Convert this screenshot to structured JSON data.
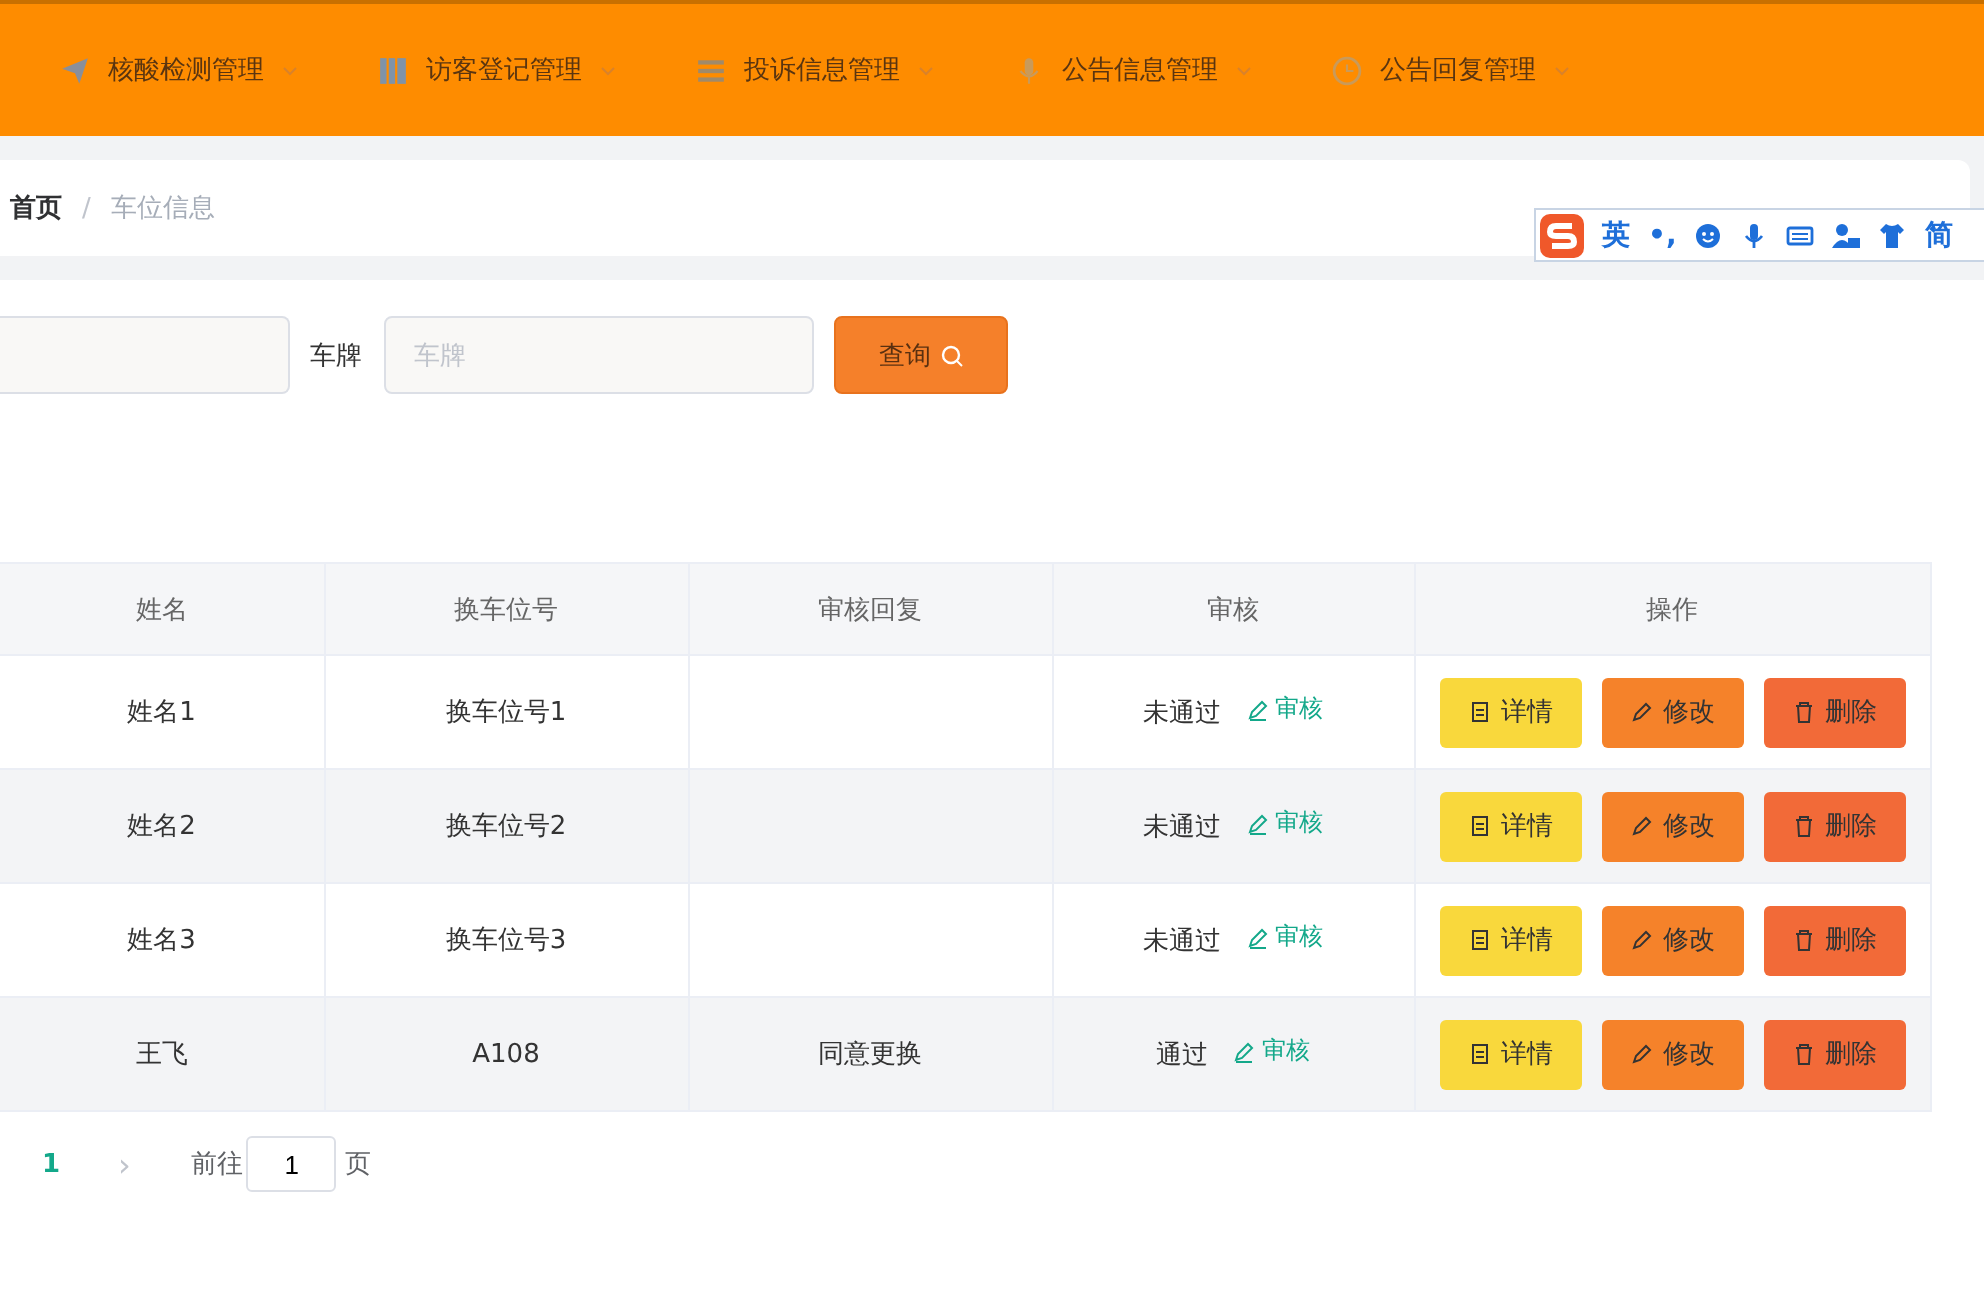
{
  "nav": [
    "核酸检测管理",
    "访客登记管理",
    "投诉信息管理",
    "公告信息管理",
    "公告回复管理"
  ],
  "breadcrumb": {
    "items": [
      "首页",
      "车位信息"
    ],
    "separator": "/"
  },
  "filter": {
    "label": "车牌",
    "placeholder": "车牌"
  },
  "search_button": "查询",
  "table": {
    "columns": [
      "姓名",
      "换车位号",
      "审核回复",
      "审核",
      "操作"
    ],
    "rows": [
      {
        "cells": [
          "姓名1",
          "换车位号1",
          "",
          "未通过"
        ],
        "review": "审核",
        "actions": [
          "详情",
          "修改",
          "删除"
        ]
      },
      {
        "cells": [
          "姓名2",
          "换车位号2",
          "",
          "未通过"
        ],
        "review": "审核",
        "actions": [
          "详情",
          "修改",
          "删除"
        ]
      },
      {
        "cells": [
          "姓名3",
          "换车位号3",
          "",
          "未通过"
        ],
        "review": "审核",
        "actions": [
          "详情",
          "修改",
          "删除"
        ]
      },
      {
        "cells": [
          "王飞",
          "A108",
          "同意更换",
          "通过"
        ],
        "review": "审核",
        "actions": [
          "详情",
          "修改",
          "删除"
        ]
      }
    ]
  },
  "pagination": {
    "pages": [
      {
        "label": "1",
        "selected": true
      }
    ],
    "next": "›",
    "goto_label": "前往",
    "page_value": "1",
    "page_suffix": "页"
  },
  "ime": {
    "lang": "英",
    "punct": "•,",
    "mode": "简"
  }
}
